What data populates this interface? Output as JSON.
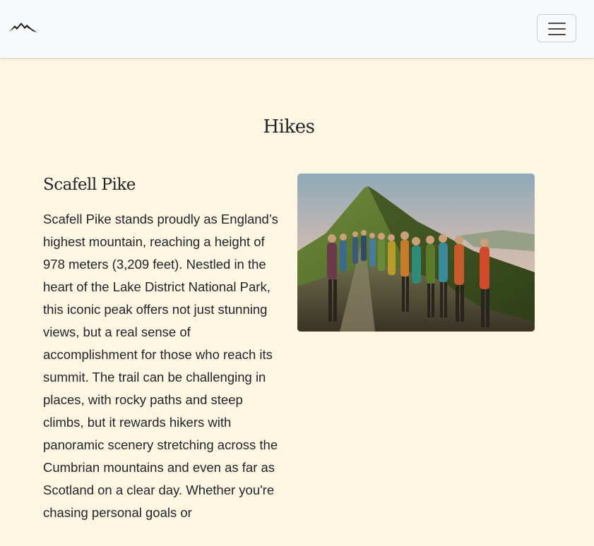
{
  "navbar": {
    "logo_icon": "mountain-icon",
    "menu_icon": "hamburger-icon"
  },
  "main": {
    "page_title": "Hikes",
    "hikes": [
      {
        "title": "Scafell Pike",
        "description": "Scafell Pike stands proudly as England’s highest mountain, reaching a height of 978 meters (3,209 feet). Nestled in the heart of the Lake District National Park, this iconic peak offers not just stunning views, but a real sense of accomplishment for those who reach its summit. The trail can be challenging in places, with rocky paths and steep climbs, but it rewards hikers with panoramic scenery stretching across the Cumbrian mountains and even as far as Scotland on a clear day. Whether you're chasing personal goals or",
        "image_subject": "group of hikers walking up a mountain ridge trail at sunset"
      }
    ]
  },
  "colors": {
    "page_background": "#fdf6e3",
    "navbar_background": "#f8f9fa",
    "text": "#212529"
  }
}
